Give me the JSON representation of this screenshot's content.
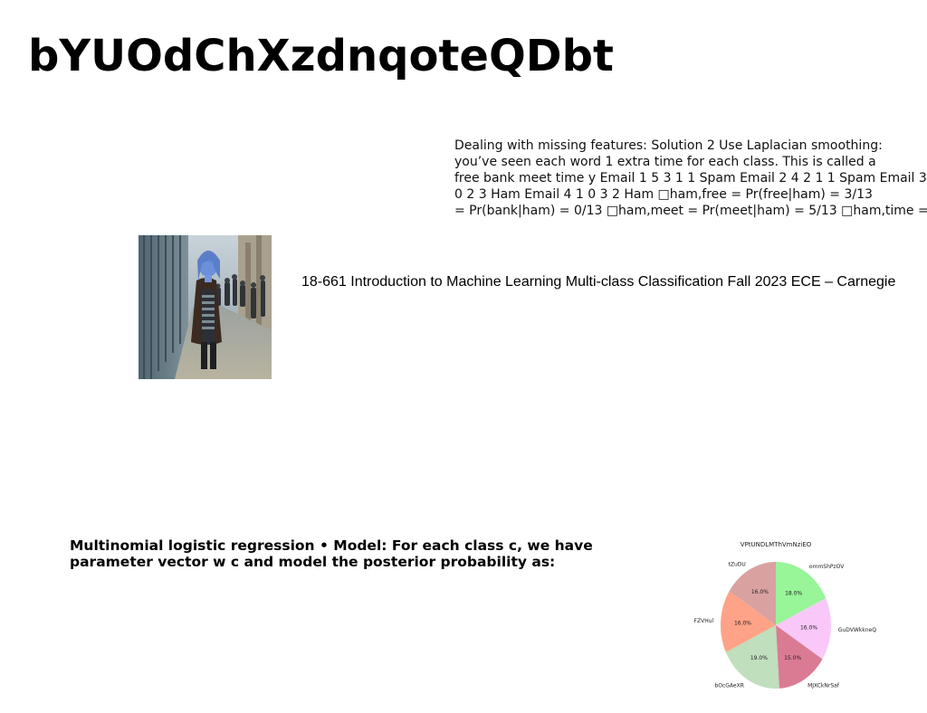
{
  "header": {
    "title": "bYUOdChXzdnqoteQDbt"
  },
  "right_paragraph": {
    "lines": [
      "Dealing with missing features: Solution 2 Use Laplacian smoothing:",
      "you’ve seen each word 1 extra time for each class. This is called a",
      "free bank meet time y Email 1 5 3 1 1 Spam Email 2 4 2 1 1 Spam Email 3",
      "0 2 3 Ham Email 4 1 0 3 2 Ham □ham,free = Pr(free|ham) = 3/13",
      "= Pr(bank|ham) = 0/13 □ham,meet = Pr(meet|ham) = 5/13 □ham,time ="
    ]
  },
  "course_line": "18-661 Introduction to Machine Learning Multi-class Classification Fall 2023 ECE – Carnegie",
  "bold_paragraph": {
    "lines": [
      "Multinomial logistic regression • Model: For each class c, we have",
      "parameter vector w c and model the posterior probability as:"
    ]
  },
  "chart_data": {
    "type": "pie",
    "title": "VPtUNDLMThVmNziEO",
    "slices": [
      {
        "label": "ommShPzOV",
        "value": 18.0,
        "display": "18.0%",
        "color": "#98f598"
      },
      {
        "label": "GuDVWkkneQ",
        "value": 16.0,
        "display": "16.0%",
        "color": "#f9c8f9"
      },
      {
        "label": "MJXCkNrSaf",
        "value": 15.0,
        "display": "15.0%",
        "color": "#db7b93"
      },
      {
        "label": "bOcGAeXR",
        "value": 19.0,
        "display": "19.0%",
        "color": "#c0dfbd"
      },
      {
        "label": "FZVHul",
        "value": 16.0,
        "display": "16.0%",
        "color": "#fea387"
      },
      {
        "label": "tZuDU",
        "value": 16.0,
        "display": "16.0%",
        "color": "#daa1a1"
      }
    ],
    "start_angle_deg": 90,
    "direction": "clockwise"
  }
}
